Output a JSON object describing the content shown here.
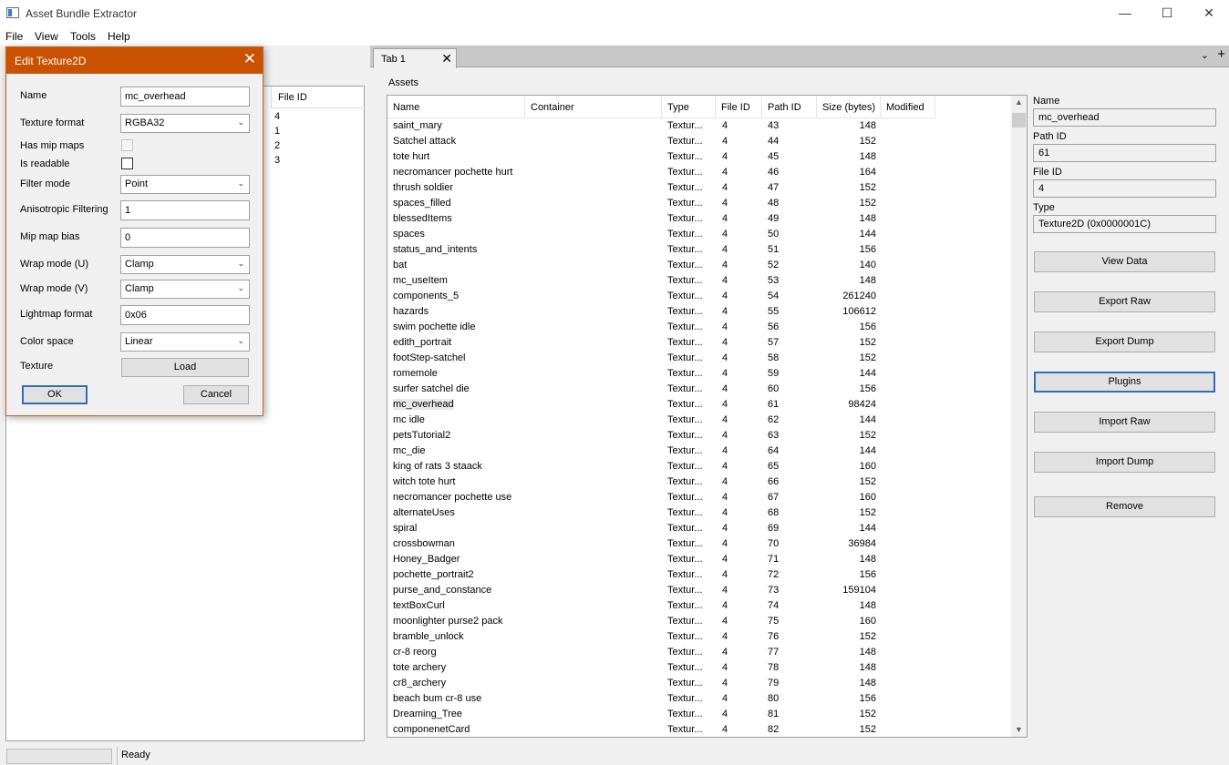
{
  "window": {
    "title": "Asset Bundle Extractor",
    "minimize": "—",
    "maximize": "☐",
    "close": "✕"
  },
  "menu": [
    "File",
    "View",
    "Tools",
    "Help"
  ],
  "left_pane": {
    "column": "File ID",
    "rows": [
      "4",
      "1",
      "2",
      "3"
    ]
  },
  "tabs": {
    "active": "Tab 1",
    "close_icon": "✕",
    "chevron_icon": "⌄",
    "add_icon": "+"
  },
  "assets": {
    "label": "Assets",
    "columns": [
      "Name",
      "Container",
      "Type",
      "File ID",
      "Path ID",
      "Size (bytes)",
      "Modified"
    ],
    "rows": [
      {
        "name": "saint_mary",
        "type": "Textur...",
        "file_id": "4",
        "path_id": "43",
        "size": "148"
      },
      {
        "name": "Satchel attack",
        "type": "Textur...",
        "file_id": "4",
        "path_id": "44",
        "size": "152"
      },
      {
        "name": "tote hurt",
        "type": "Textur...",
        "file_id": "4",
        "path_id": "45",
        "size": "148"
      },
      {
        "name": "necromancer pochette hurt",
        "type": "Textur...",
        "file_id": "4",
        "path_id": "46",
        "size": "164"
      },
      {
        "name": "thrush soldier",
        "type": "Textur...",
        "file_id": "4",
        "path_id": "47",
        "size": "152"
      },
      {
        "name": "spaces_filled",
        "type": "Textur...",
        "file_id": "4",
        "path_id": "48",
        "size": "152"
      },
      {
        "name": "blessedItems",
        "type": "Textur...",
        "file_id": "4",
        "path_id": "49",
        "size": "148"
      },
      {
        "name": "spaces",
        "type": "Textur...",
        "file_id": "4",
        "path_id": "50",
        "size": "144"
      },
      {
        "name": "status_and_intents",
        "type": "Textur...",
        "file_id": "4",
        "path_id": "51",
        "size": "156"
      },
      {
        "name": "bat",
        "type": "Textur...",
        "file_id": "4",
        "path_id": "52",
        "size": "140"
      },
      {
        "name": "mc_useItem",
        "type": "Textur...",
        "file_id": "4",
        "path_id": "53",
        "size": "148"
      },
      {
        "name": "components_5",
        "type": "Textur...",
        "file_id": "4",
        "path_id": "54",
        "size": "261240"
      },
      {
        "name": "hazards",
        "type": "Textur...",
        "file_id": "4",
        "path_id": "55",
        "size": "106612"
      },
      {
        "name": "swim pochette idle",
        "type": "Textur...",
        "file_id": "4",
        "path_id": "56",
        "size": "156"
      },
      {
        "name": "edith_portrait",
        "type": "Textur...",
        "file_id": "4",
        "path_id": "57",
        "size": "152"
      },
      {
        "name": "footStep-satchel",
        "type": "Textur...",
        "file_id": "4",
        "path_id": "58",
        "size": "152"
      },
      {
        "name": "romemole",
        "type": "Textur...",
        "file_id": "4",
        "path_id": "59",
        "size": "144"
      },
      {
        "name": "surfer satchel die",
        "type": "Textur...",
        "file_id": "4",
        "path_id": "60",
        "size": "156"
      },
      {
        "name": "mc_overhead",
        "type": "Textur...",
        "file_id": "4",
        "path_id": "61",
        "size": "98424",
        "selected": true
      },
      {
        "name": "mc idle",
        "type": "Textur...",
        "file_id": "4",
        "path_id": "62",
        "size": "144"
      },
      {
        "name": "petsTutorial2",
        "type": "Textur...",
        "file_id": "4",
        "path_id": "63",
        "size": "152"
      },
      {
        "name": "mc_die",
        "type": "Textur...",
        "file_id": "4",
        "path_id": "64",
        "size": "144"
      },
      {
        "name": "king of rats 3 staack",
        "type": "Textur...",
        "file_id": "4",
        "path_id": "65",
        "size": "160"
      },
      {
        "name": "witch tote hurt",
        "type": "Textur...",
        "file_id": "4",
        "path_id": "66",
        "size": "152"
      },
      {
        "name": "necromancer pochette use",
        "type": "Textur...",
        "file_id": "4",
        "path_id": "67",
        "size": "160"
      },
      {
        "name": "alternateUses",
        "type": "Textur...",
        "file_id": "4",
        "path_id": "68",
        "size": "152"
      },
      {
        "name": "spiral",
        "type": "Textur...",
        "file_id": "4",
        "path_id": "69",
        "size": "144"
      },
      {
        "name": "crossbowman",
        "type": "Textur...",
        "file_id": "4",
        "path_id": "70",
        "size": "36984"
      },
      {
        "name": "Honey_Badger",
        "type": "Textur...",
        "file_id": "4",
        "path_id": "71",
        "size": "148"
      },
      {
        "name": "pochette_portrait2",
        "type": "Textur...",
        "file_id": "4",
        "path_id": "72",
        "size": "156"
      },
      {
        "name": "purse_and_constance",
        "type": "Textur...",
        "file_id": "4",
        "path_id": "73",
        "size": "159104"
      },
      {
        "name": "textBoxCurl",
        "type": "Textur...",
        "file_id": "4",
        "path_id": "74",
        "size": "148"
      },
      {
        "name": "moonlighter purse2 pack",
        "type": "Textur...",
        "file_id": "4",
        "path_id": "75",
        "size": "160"
      },
      {
        "name": "bramble_unlock",
        "type": "Textur...",
        "file_id": "4",
        "path_id": "76",
        "size": "152"
      },
      {
        "name": "cr-8 reorg",
        "type": "Textur...",
        "file_id": "4",
        "path_id": "77",
        "size": "148"
      },
      {
        "name": "tote archery",
        "type": "Textur...",
        "file_id": "4",
        "path_id": "78",
        "size": "148"
      },
      {
        "name": "cr8_archery",
        "type": "Textur...",
        "file_id": "4",
        "path_id": "79",
        "size": "148"
      },
      {
        "name": "beach bum cr-8 use",
        "type": "Textur...",
        "file_id": "4",
        "path_id": "80",
        "size": "156"
      },
      {
        "name": "Dreaming_Tree",
        "type": "Textur...",
        "file_id": "4",
        "path_id": "81",
        "size": "152"
      },
      {
        "name": "componenetCard",
        "type": "Textur...",
        "file_id": "4",
        "path_id": "82",
        "size": "152"
      }
    ]
  },
  "info": {
    "name_label": "Name",
    "name_value": "mc_overhead",
    "path_id_label": "Path ID",
    "path_id_value": "61",
    "file_id_label": "File ID",
    "file_id_value": "4",
    "type_label": "Type",
    "type_value": "Texture2D (0x0000001C)"
  },
  "side_buttons": {
    "view_data": "View Data",
    "export_raw": "Export Raw",
    "export_dump": "Export Dump",
    "plugins": "Plugins",
    "import_raw": "Import Raw",
    "import_dump": "Import Dump",
    "remove": "Remove"
  },
  "status": {
    "text": "Ready"
  },
  "dialog": {
    "title": "Edit Texture2D",
    "close_icon": "✕",
    "chevron_icon": "⌄",
    "fields": {
      "name_label": "Name",
      "name_value": "mc_overhead",
      "texture_format_label": "Texture format",
      "texture_format_value": "RGBA32",
      "has_mip_maps_label": "Has mip maps",
      "is_readable_label": "Is readable",
      "filter_mode_label": "Filter mode",
      "filter_mode_value": "Point",
      "aniso_label": "Anisotropic Filtering",
      "aniso_value": "1",
      "mip_bias_label": "Mip map bias",
      "mip_bias_value": "0",
      "wrap_u_label": "Wrap mode (U)",
      "wrap_u_value": "Clamp",
      "wrap_v_label": "Wrap mode (V)",
      "wrap_v_value": "Clamp",
      "lightmap_label": "Lightmap format",
      "lightmap_value": "0x06",
      "color_space_label": "Color space",
      "color_space_value": "Linear",
      "texture_label": "Texture"
    },
    "load_button": "Load",
    "ok_button": "OK",
    "cancel_button": "Cancel"
  }
}
